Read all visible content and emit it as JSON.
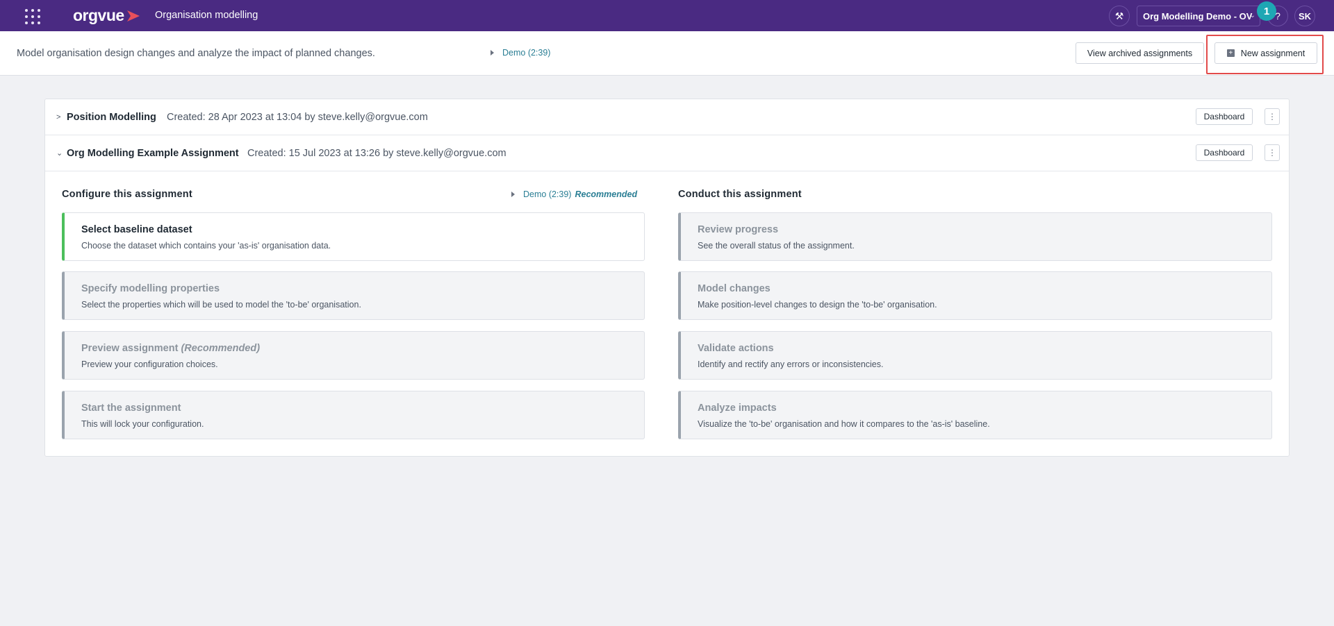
{
  "topbar": {
    "logo_text": "orgvue",
    "app_title": "Organisation modelling",
    "tenant": "Org Modelling Demo - OV",
    "notification_count": "1",
    "help": "?",
    "user_initials": "SK",
    "brand_color": "#4a2a82"
  },
  "header": {
    "description": "Model organisation design changes and analyze the impact of planned changes.",
    "demo_link": "Demo (2:39)",
    "view_archived": "View archived assignments",
    "new_assignment": "New assignment"
  },
  "assignments": [
    {
      "name": "Position Modelling",
      "meta": "Created: 28 Apr 2023 at 13:04 by steve.kelly@orgvue.com",
      "expanded": false,
      "dashboard": "Dashboard"
    },
    {
      "name": "Org Modelling Example Assignment",
      "meta": "Created: 15 Jul 2023 at 13:26 by steve.kelly@orgvue.com",
      "expanded": true,
      "dashboard": "Dashboard"
    }
  ],
  "configure": {
    "title": "Configure this assignment",
    "demo_link": "Demo (2:39)",
    "recommended": "Recommended",
    "steps": [
      {
        "title": "Select baseline dataset",
        "desc": "Choose the dataset which contains your 'as-is' organisation data.",
        "active": true
      },
      {
        "title": "Specify modelling properties",
        "desc": "Select the properties which will be used to model the 'to-be' organisation."
      },
      {
        "title": "Preview assignment",
        "title_suffix": "(Recommended)",
        "desc": "Preview your configuration choices."
      },
      {
        "title": "Start the assignment",
        "desc": "This will lock your configuration."
      }
    ]
  },
  "conduct": {
    "title": "Conduct this assignment",
    "steps": [
      {
        "title": "Review progress",
        "desc": "See the overall status of the assignment."
      },
      {
        "title": "Model changes",
        "desc": "Make position-level changes to design the 'to-be' organisation."
      },
      {
        "title": "Validate actions",
        "desc": "Identify and rectify any errors or inconsistencies."
      },
      {
        "title": "Analyze impacts",
        "desc": "Visualize the 'to-be' organisation and how it compares to the 'as-is' baseline."
      }
    ]
  }
}
